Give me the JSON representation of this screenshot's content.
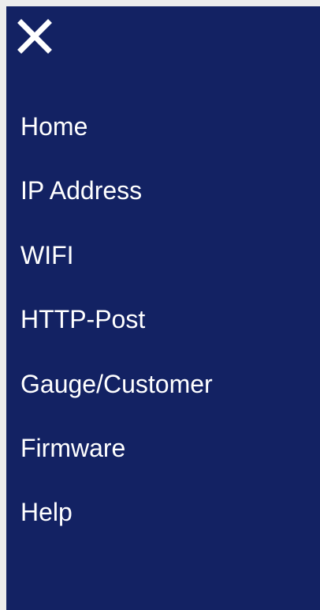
{
  "drawer": {
    "background_color": "#132263",
    "text_color": "#ffffff",
    "close_icon": "close-icon",
    "menu_items": [
      {
        "label": "Home"
      },
      {
        "label": "IP Address"
      },
      {
        "label": "WIFI"
      },
      {
        "label": "HTTP-Post"
      },
      {
        "label": "Gauge/Customer"
      },
      {
        "label": "Firmware"
      },
      {
        "label": "Help"
      }
    ]
  }
}
